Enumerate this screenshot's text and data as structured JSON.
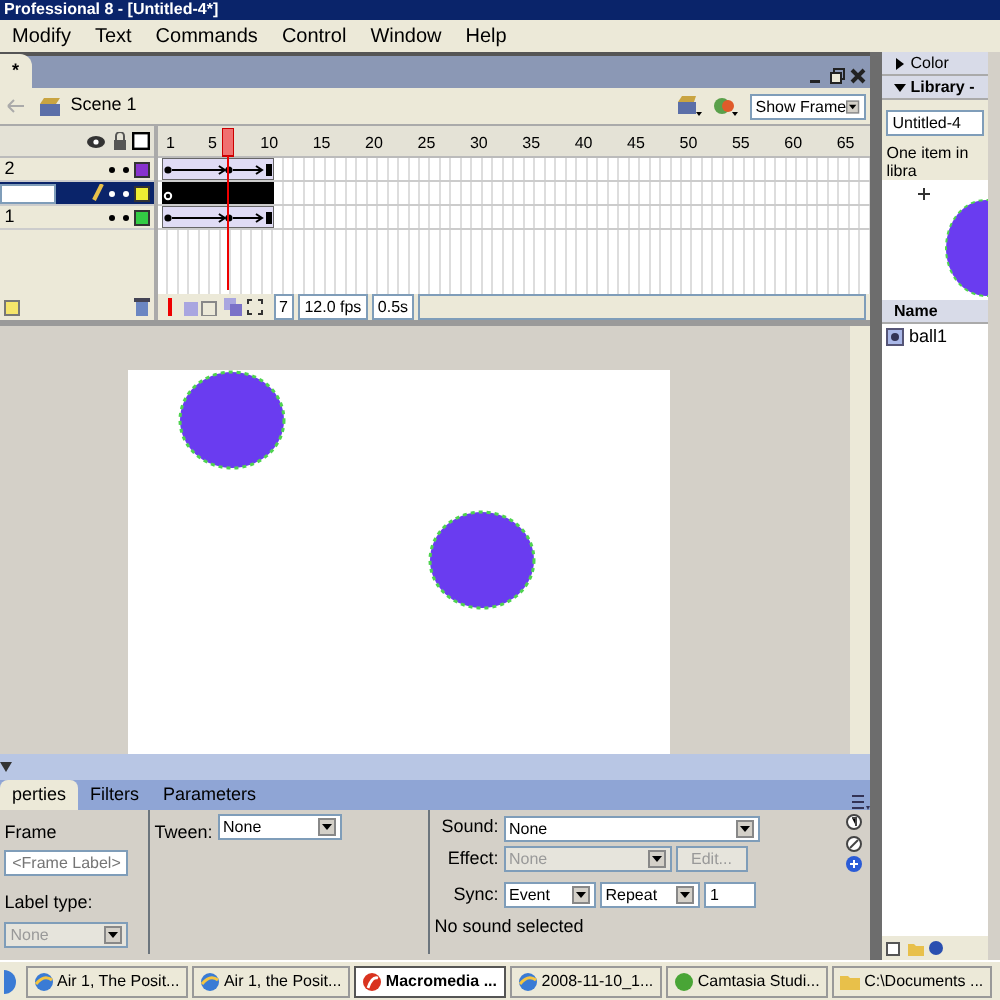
{
  "window": {
    "title": "Professional 8 - [Untitled-4*]"
  },
  "menu": [
    "Modify",
    "Text",
    "Commands",
    "Control",
    "Window",
    "Help"
  ],
  "document_tab": {
    "label": "*"
  },
  "edit_bar": {
    "scene": "Scene 1",
    "view": "Show Frame"
  },
  "timeline": {
    "ruler": [
      "1",
      "5",
      "10",
      "15",
      "20",
      "25",
      "30",
      "35",
      "40",
      "45",
      "50",
      "55",
      "60",
      "65"
    ],
    "layers": [
      {
        "name": "2",
        "selected": false,
        "color": "#8833cc",
        "tween": true
      },
      {
        "selected": true,
        "color": "#eeee33",
        "tween": false
      },
      {
        "name": "1",
        "selected": false,
        "color": "#33cc44",
        "tween": true
      }
    ],
    "frame": "7",
    "fps": "12.0 fps",
    "time": "0.5s"
  },
  "properties": {
    "tabs": [
      {
        "label": "perties",
        "selected": true
      },
      {
        "label": "Filters",
        "selected": false
      },
      {
        "label": "Parameters",
        "selected": false
      }
    ],
    "frame_heading": "Frame",
    "frame_label": {
      "placeholder": "<Frame Label>"
    },
    "label_type_label": "Label type:",
    "label_type": {
      "value": "None",
      "disabled": true
    },
    "tween_label": "Tween:",
    "tween": "None",
    "sound_label": "Sound:",
    "sound": "None",
    "effect_label": "Effect:",
    "effect": {
      "value": "None",
      "disabled": true
    },
    "edit_button": {
      "label": "Edit...",
      "disabled": true
    },
    "sync_label": "Sync:",
    "sync": "Event",
    "repeat": "Repeat",
    "repeat_count": "1",
    "status": "No sound selected"
  },
  "side_panels": [
    {
      "title": "Color",
      "expanded": false
    },
    {
      "title": "Library - ",
      "expanded": true
    }
  ],
  "library": {
    "document": "Untitled-4",
    "summary": "One item in libra",
    "column": "Name",
    "items": [
      "ball1"
    ]
  },
  "taskbar": [
    {
      "label": "Air 1, The Posit...",
      "selected": false,
      "kind": "browser"
    },
    {
      "label": "Air 1, the Posit...",
      "selected": false,
      "kind": "browser"
    },
    {
      "label": "Macromedia ...",
      "selected": true,
      "kind": "flash"
    },
    {
      "label": "2008-11-10_1...",
      "selected": false,
      "kind": "browser"
    },
    {
      "label": "Camtasia Studi...",
      "selected": false,
      "kind": "camtasia"
    },
    {
      "label": "C:\\Documents ...",
      "selected": false,
      "kind": "folder"
    }
  ]
}
